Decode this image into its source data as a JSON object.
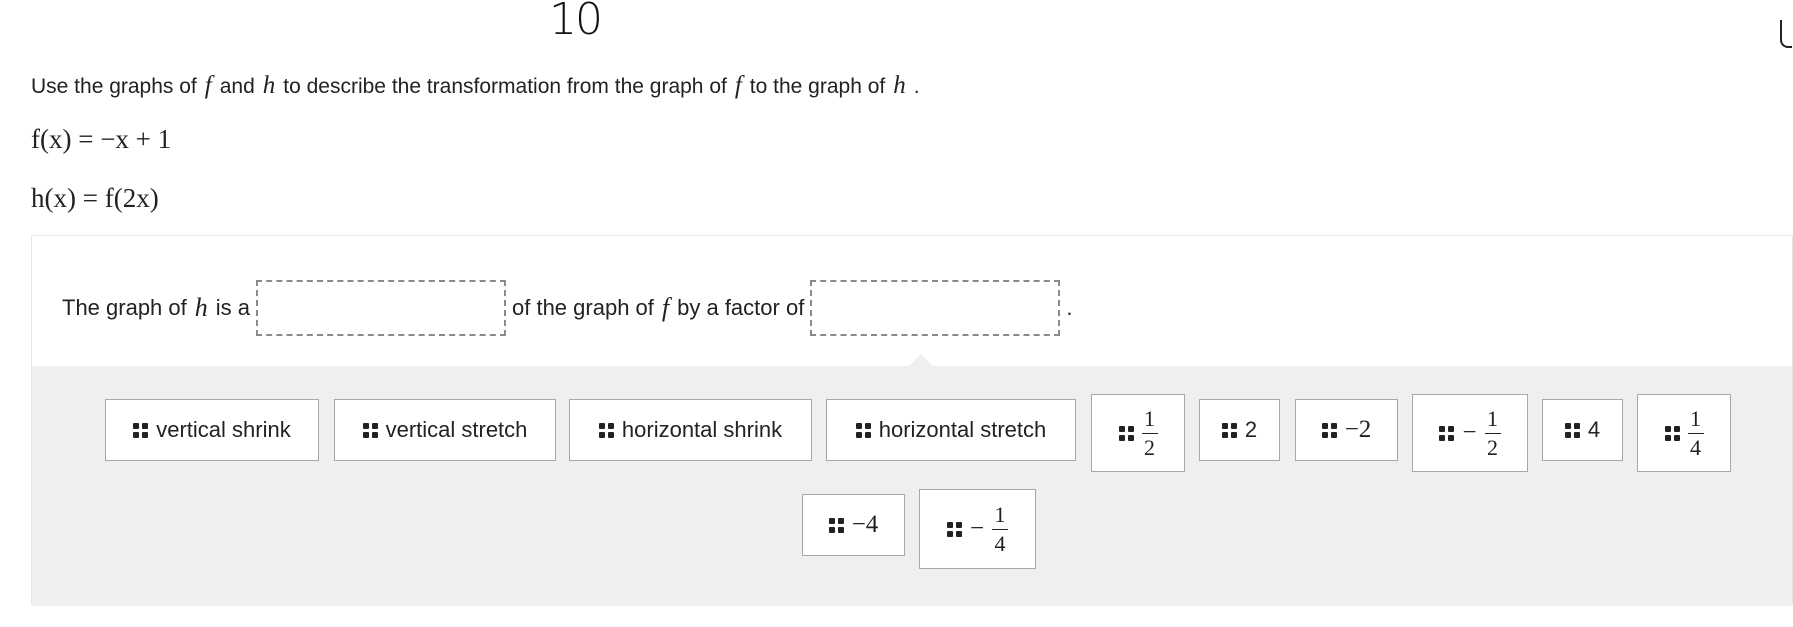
{
  "top_mark": "10",
  "question": {
    "p1": "Use the graphs of",
    "f": "f",
    "p2": "and",
    "h": "h",
    "p3": "to describe the transformation from the graph of",
    "f2": "f",
    "p4": "to the graph of",
    "h2": "h",
    "p5": "."
  },
  "equations": {
    "f_def": "f(x) = −x + 1",
    "h_def": "h(x) = f(2x)"
  },
  "sentence": {
    "p1": "The graph of",
    "h": "h",
    "p2": "is a",
    "p3": "of the graph of",
    "f": "f",
    "p4": "by a factor of",
    "p5": "."
  },
  "tiles": {
    "vertical_shrink": "vertical shrink",
    "vertical_stretch": "vertical stretch",
    "horizontal_shrink": "horizontal shrink",
    "horizontal_stretch": "horizontal stretch",
    "half_num": "1",
    "half_den": "2",
    "two": "2",
    "neg_two": "−2",
    "neg_half_sign": "−",
    "neg_half_num": "1",
    "neg_half_den": "2",
    "four": "4",
    "quarter_num": "1",
    "quarter_den": "4",
    "neg_four": "−4",
    "neg_quarter_sign": "−",
    "neg_quarter_num": "1",
    "neg_quarter_den": "4"
  }
}
